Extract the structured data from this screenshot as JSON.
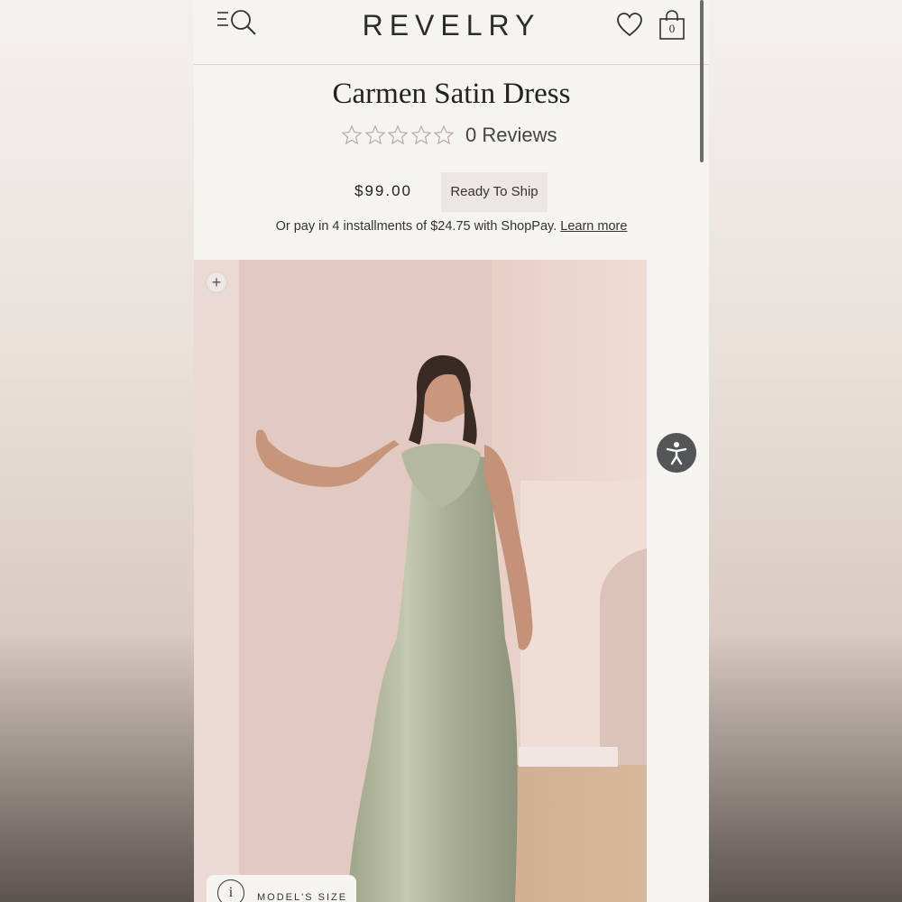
{
  "header": {
    "logo": "REVELRY",
    "cart_count": "0"
  },
  "product": {
    "title": "Carmen Satin Dress",
    "rating_stars": 0,
    "reviews_label": "0 Reviews",
    "price": "$99.00",
    "badge": "Ready To Ship",
    "installments_text": "Or pay in 4 installments of $24.75 with ShopPay.",
    "learn_more": "Learn more"
  },
  "gallery": {
    "zoom_symbol": "+",
    "info_symbol": "i",
    "model_size_label": "MODEL'S SIZE"
  },
  "icons": {
    "menu_search": "menu-search-icon",
    "wishlist": "heart-icon",
    "cart": "bag-icon",
    "accessibility": "accessibility-icon"
  },
  "colors": {
    "background": "#f6f4f1",
    "text": "#222222",
    "badge_bg": "#ece7e2",
    "divider": "#e6cfc9",
    "accessibility_bg": "#535557"
  }
}
